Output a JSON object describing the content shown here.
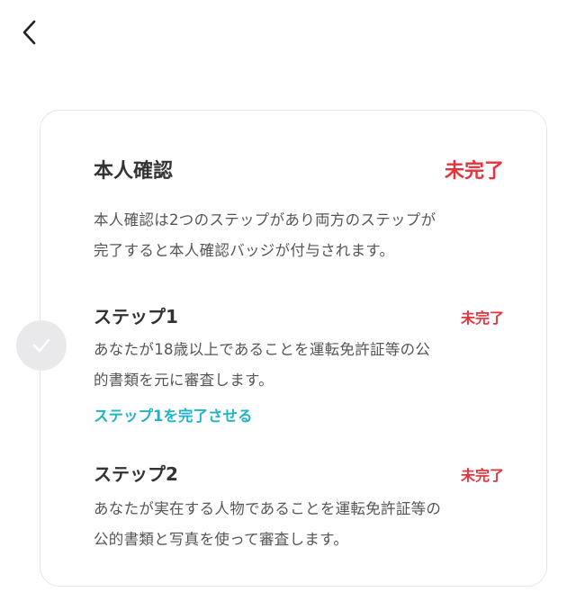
{
  "header": {
    "back_icon": "chevron-left-icon"
  },
  "identity": {
    "title": "本人確認",
    "status": "未完了",
    "description_line1": "本人確認は2つのステップがあり両方のステップが",
    "description_line2": "完了すると本人確認バッジが付与されます。"
  },
  "steps": [
    {
      "title": "ステップ1",
      "status": "未完了",
      "description_line1": "あなたが18歳以上であることを運転免許証等の公",
      "description_line2": "的書類を元に審査します。",
      "action_label": "ステップ1を完了させる",
      "indicator_icon": "check-icon"
    },
    {
      "title": "ステップ2",
      "status": "未完了",
      "description_line1": "あなたが実在する人物であることを運転免許証等の",
      "description_line2": "公的書類と写真を使って審査します。"
    }
  ],
  "colors": {
    "status_incomplete": "#e5323c",
    "link": "#21b4c4",
    "indicator": "#e9e9ec"
  }
}
